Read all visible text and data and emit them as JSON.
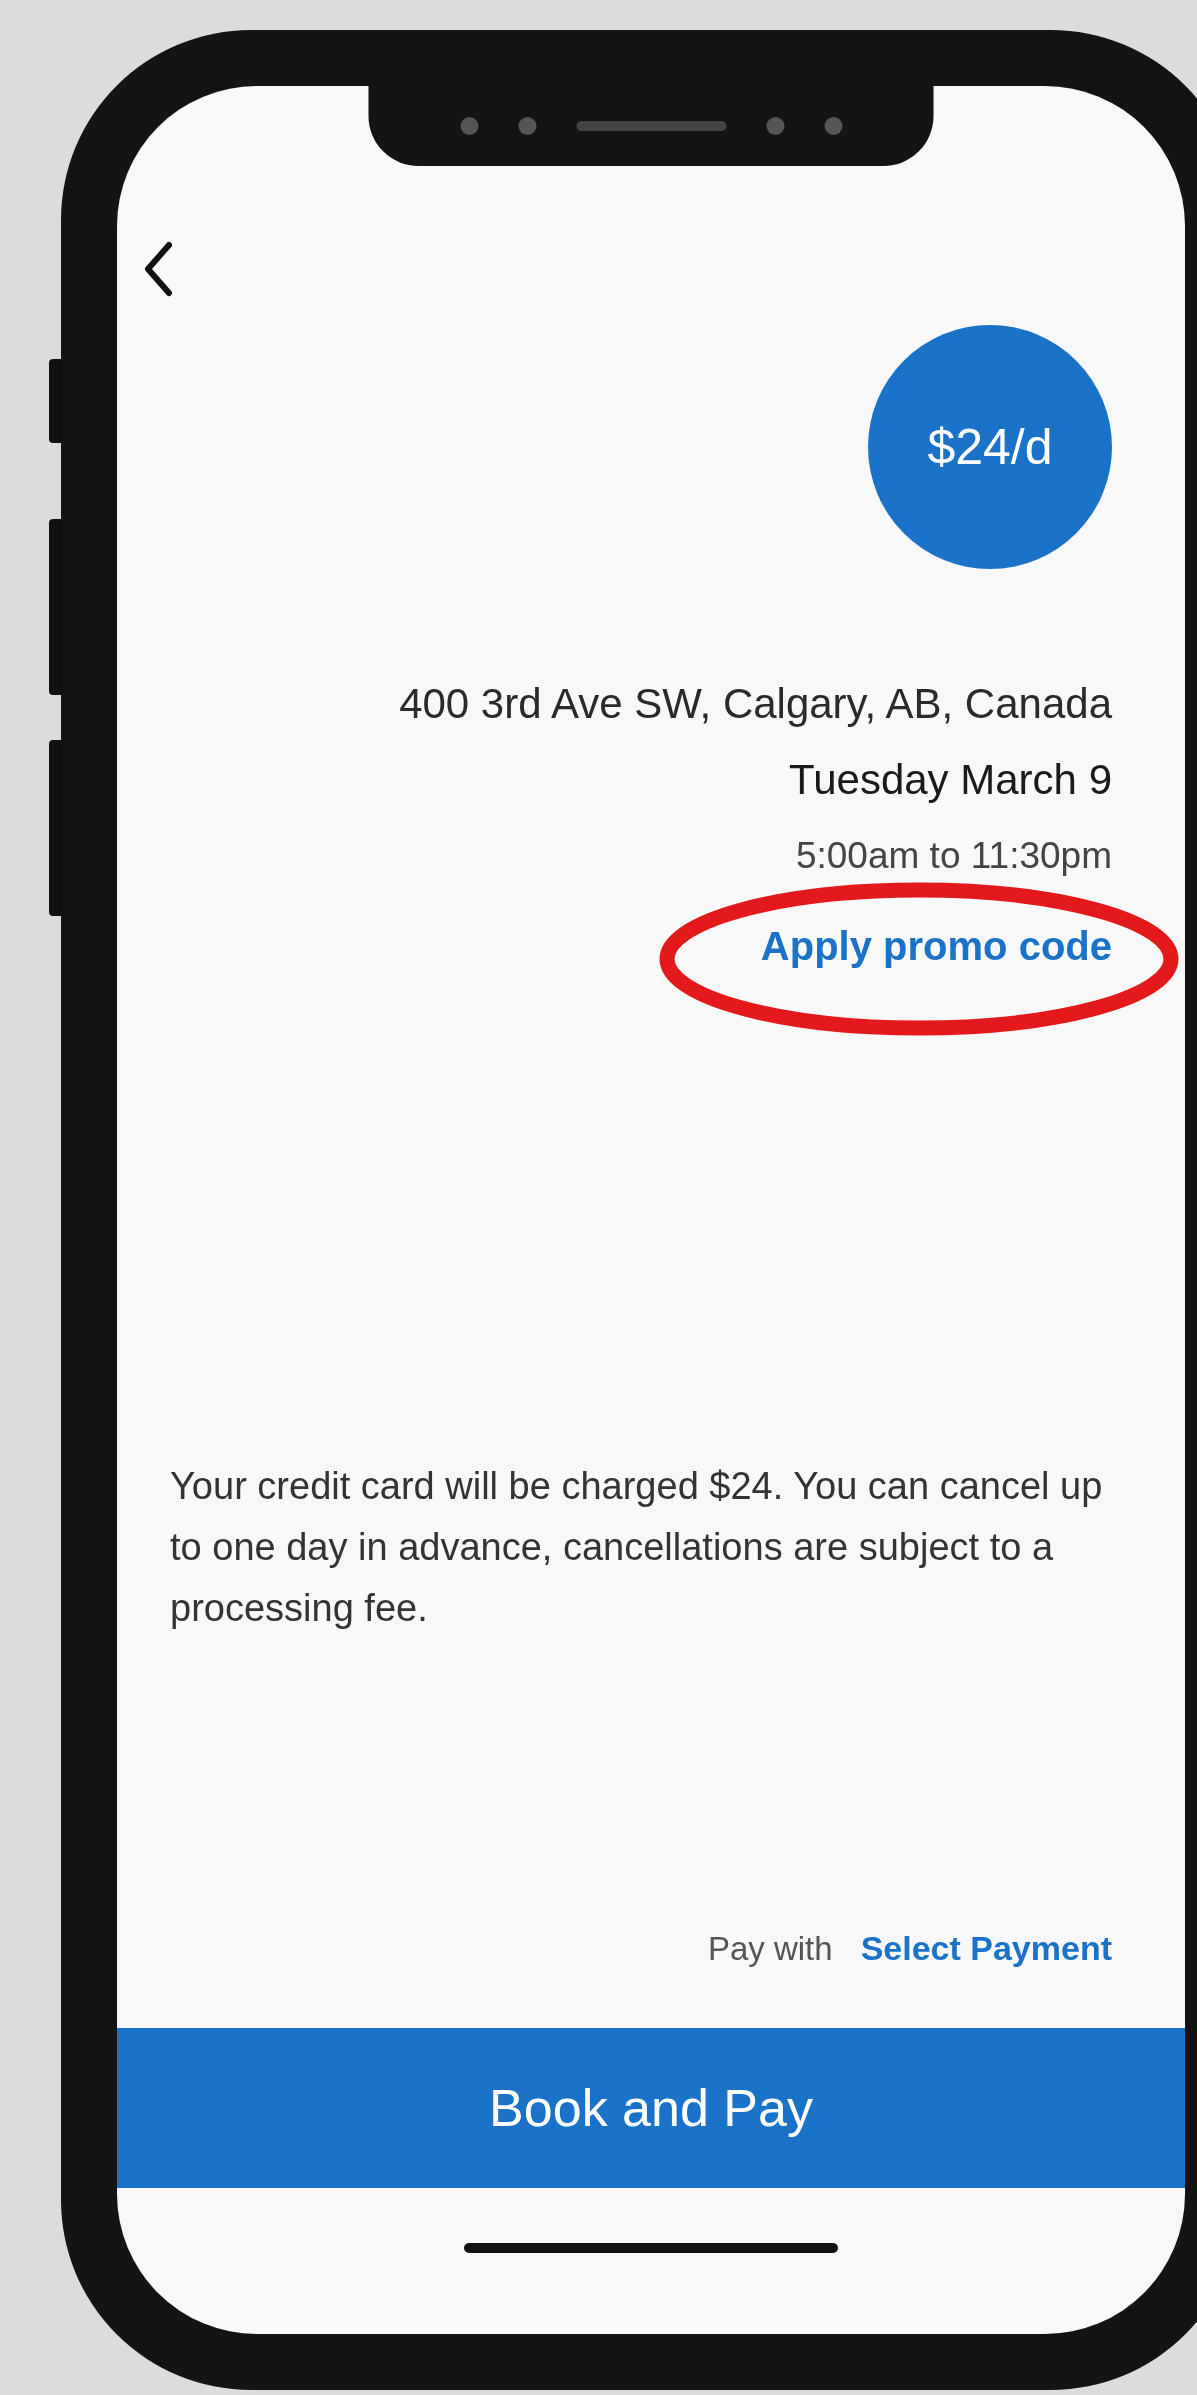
{
  "price_badge": "$24/d",
  "address": "400 3rd Ave SW, Calgary, AB, Canada",
  "date": "Tuesday March 9",
  "time": "5:00am to 11:30pm",
  "promo_link": "Apply promo code",
  "notice": "Your credit card will be charged $24. You can cancel up to one day in advance, cancellations are subject to a processing fee.",
  "payment": {
    "label": "Pay with",
    "link": "Select Payment"
  },
  "primary_button": "Book and Pay"
}
